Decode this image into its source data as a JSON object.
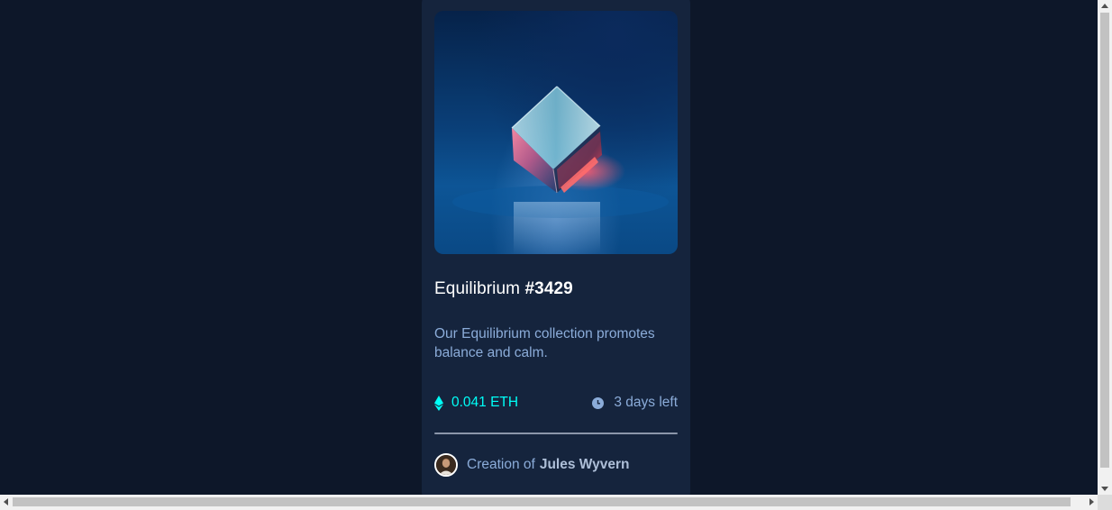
{
  "card": {
    "image_alt": "Equilibrium cube artwork",
    "title_name": "Equilibrium",
    "title_number": "#3429",
    "description": "Our Equilibrium collection promotes balance and calm.",
    "price": "0.041 ETH",
    "time_left": "3 days left",
    "creator_prefix": "Creation of",
    "creator_name": "Jules Wyvern"
  },
  "icons": {
    "price": "ethereum-icon",
    "time": "clock-icon",
    "creator": "avatar"
  },
  "colors": {
    "page_background": "#0d1729",
    "card_background": "#15243d",
    "accent_cyan": "#00fff7",
    "soft_blue": "#8bacd9",
    "white": "#ffffff"
  }
}
